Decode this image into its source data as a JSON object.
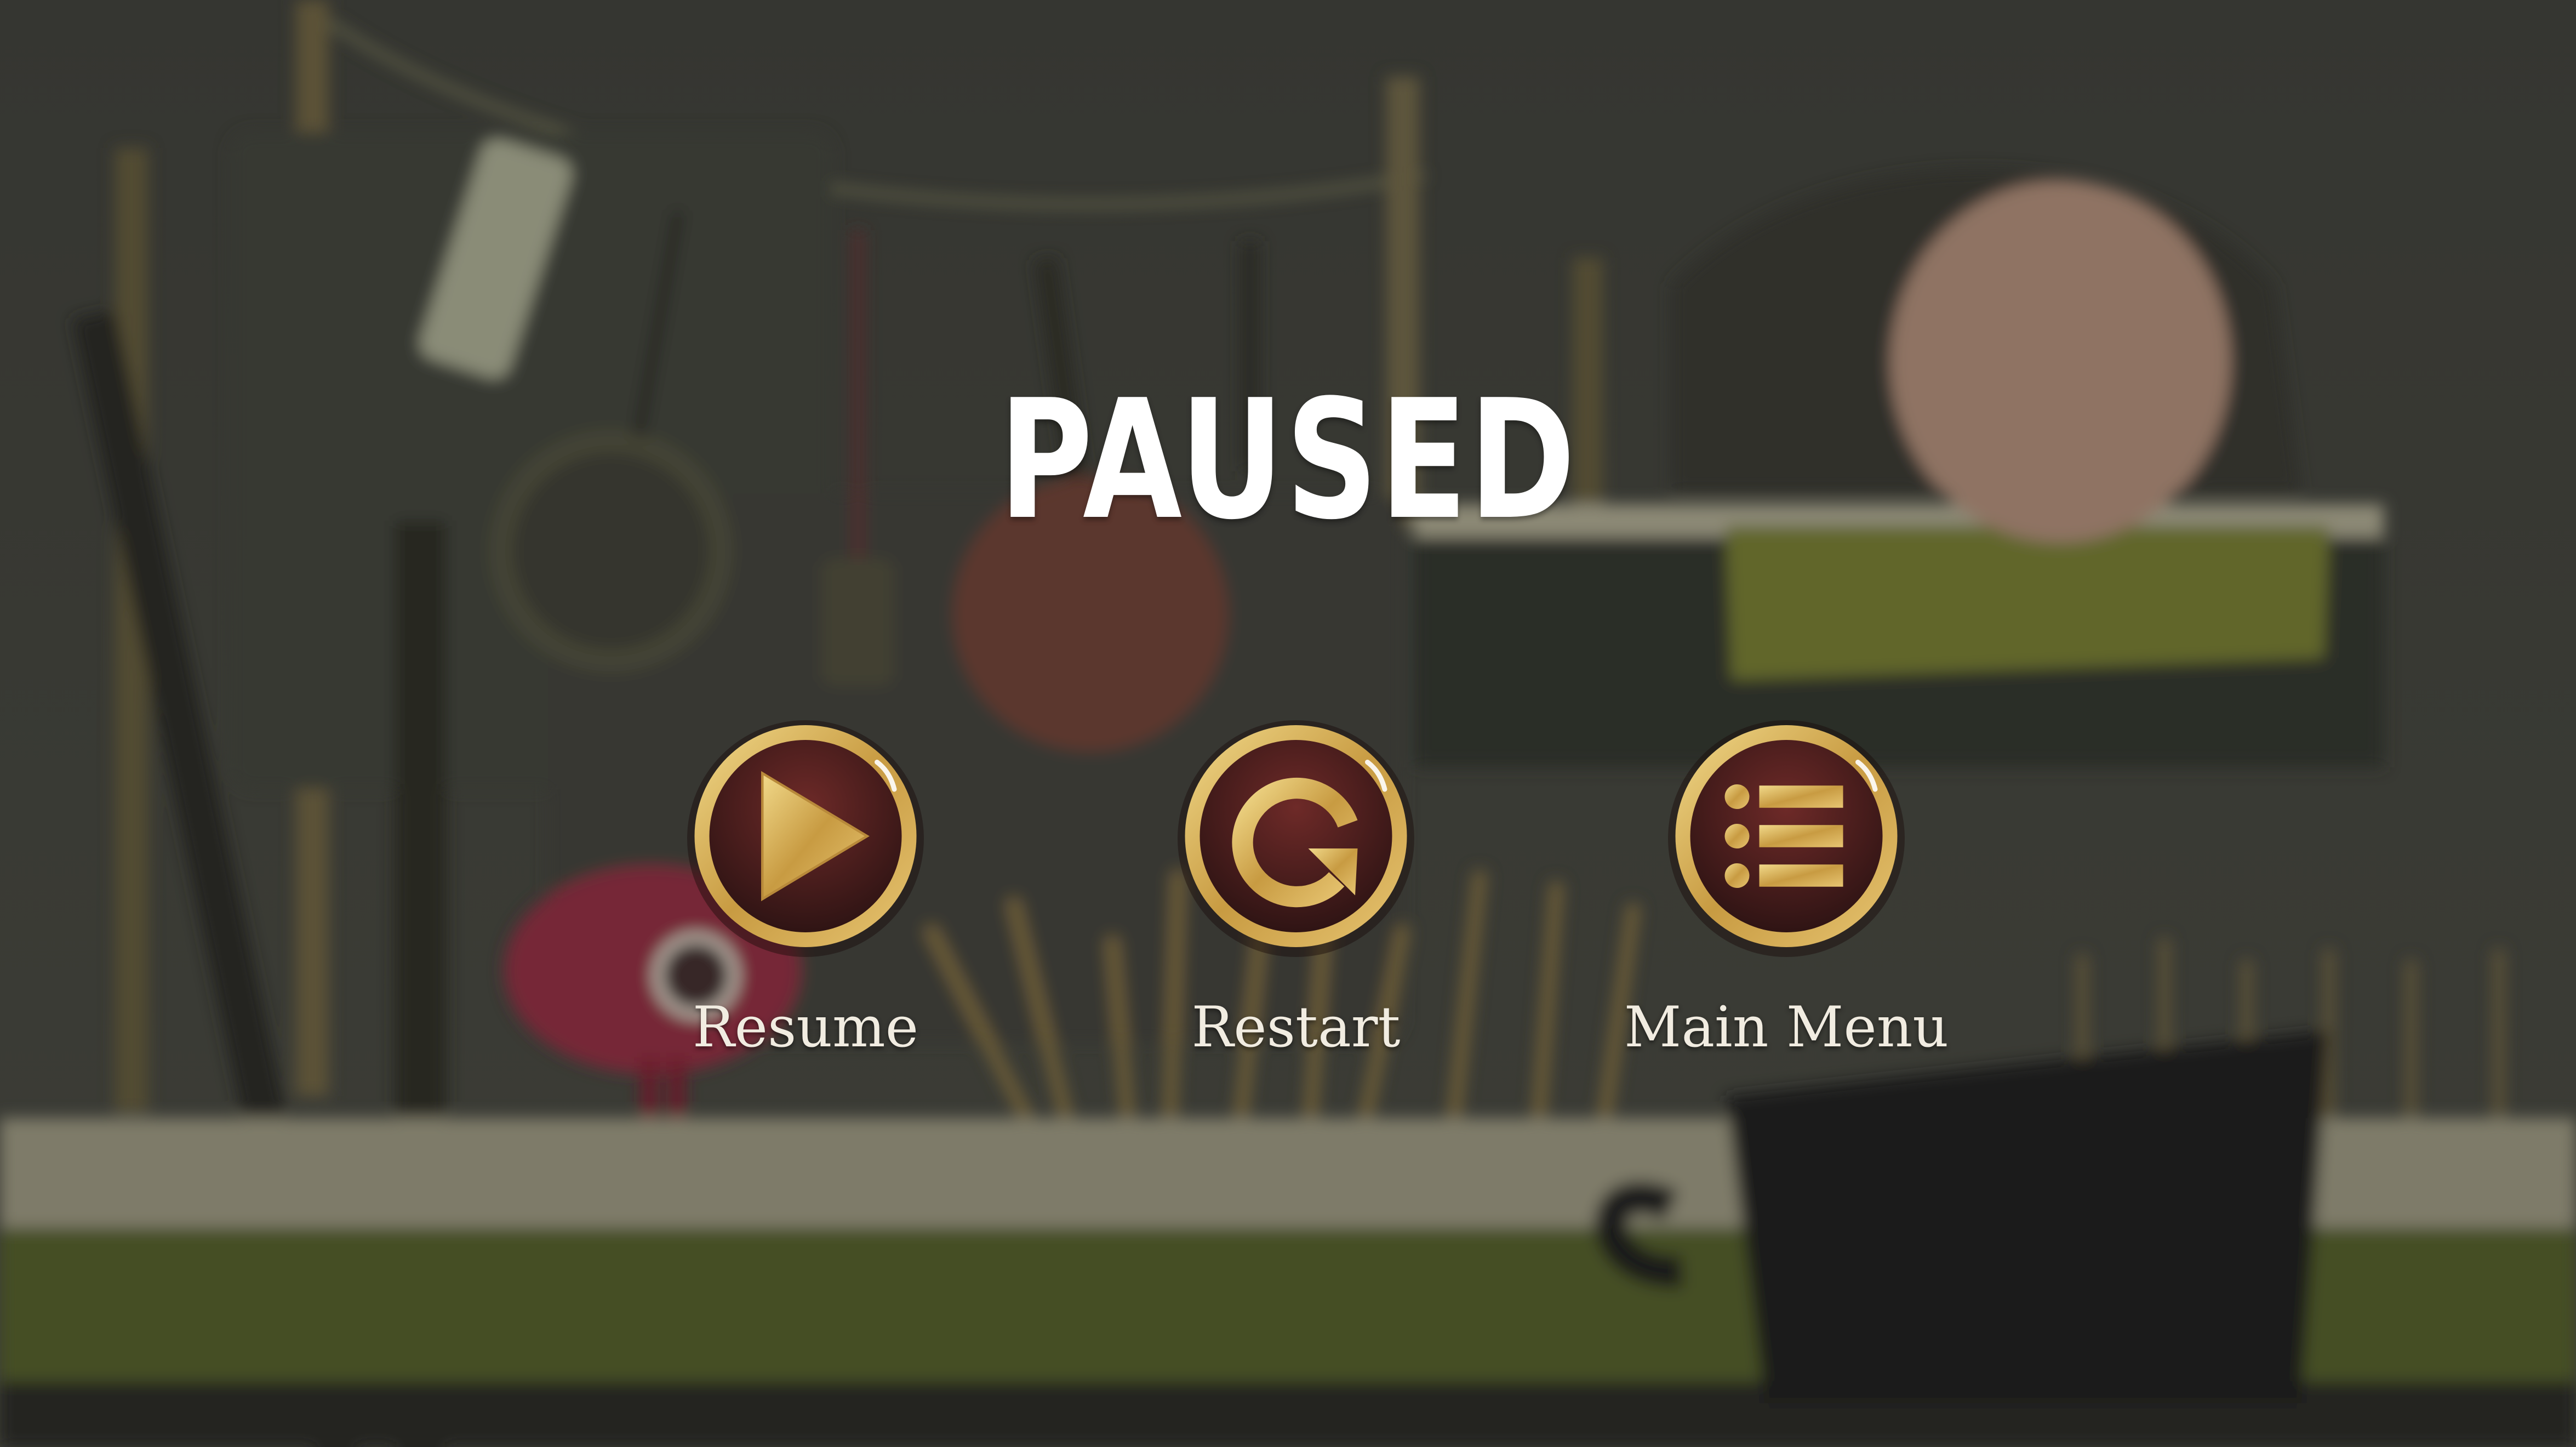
{
  "pause_menu": {
    "title": "PAUSED",
    "buttons": [
      {
        "id": "resume",
        "label": "Resume",
        "icon": "play-icon"
      },
      {
        "id": "restart",
        "label": "Restart",
        "icon": "restart-icon"
      },
      {
        "id": "main_menu",
        "label": "Main Menu",
        "icon": "list-icon"
      }
    ]
  },
  "colors": {
    "gold": "#d8b25a",
    "button_fill": "#4a1c1c",
    "label_text": "#f1ece1",
    "title_text": "#ffffff"
  }
}
